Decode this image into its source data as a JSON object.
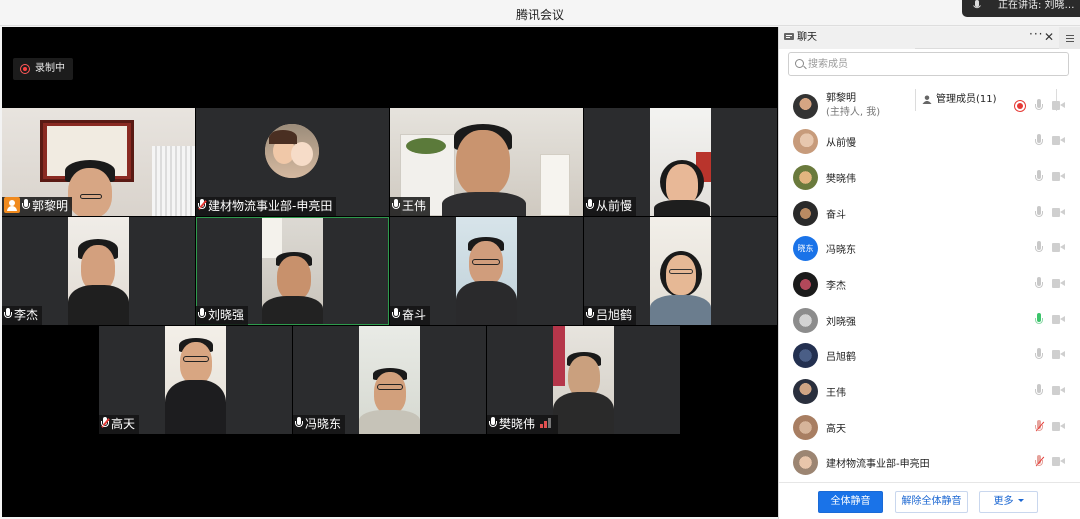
{
  "window": {
    "title": "腾讯会议"
  },
  "speaking_indicator": {
    "text": "正在讲话: 刘晓… "
  },
  "recording": {
    "label": "录制中"
  },
  "video_tiles": [
    {
      "name": "郭黎明",
      "mic": "on",
      "host": true
    },
    {
      "name": "建材物流事业部-申亮田",
      "mic": "muted"
    },
    {
      "name": "王伟",
      "mic": "on"
    },
    {
      "name": "从前慢",
      "mic": "on"
    },
    {
      "name": "李杰",
      "mic": "on"
    },
    {
      "name": "刘晓强",
      "mic": "on",
      "active": true
    },
    {
      "name": "奋斗",
      "mic": "on"
    },
    {
      "name": "吕旭鹤",
      "mic": "on"
    },
    {
      "name": "高天",
      "mic": "muted"
    },
    {
      "name": "冯晓东",
      "mic": "on"
    },
    {
      "name": "樊晓伟",
      "mic": "on",
      "weak_signal": true
    }
  ],
  "panel": {
    "tab_chat": "聊天",
    "tab_members": "管理成员(11)",
    "search_placeholder": "搜索成员",
    "members": [
      {
        "name": "郭黎明",
        "role": "(主持人, 我)",
        "recording": true,
        "mic": "on"
      },
      {
        "name": "从前慢",
        "mic": "on"
      },
      {
        "name": "樊晓伟",
        "mic": "on"
      },
      {
        "name": "奋斗",
        "mic": "on"
      },
      {
        "name": "冯晓东",
        "avatar_text": "晓东",
        "mic": "on"
      },
      {
        "name": "李杰",
        "mic": "on"
      },
      {
        "name": "刘晓强",
        "mic": "speaking"
      },
      {
        "name": "吕旭鹤",
        "mic": "on"
      },
      {
        "name": "王伟",
        "mic": "on"
      },
      {
        "name": "高天",
        "mic": "muted"
      },
      {
        "name": "建材物流事业部-申亮田",
        "mic": "muted"
      }
    ],
    "buttons": {
      "mute_all": "全体静音",
      "unmute_all": "解除全体静音",
      "more": "更多"
    }
  },
  "colors": {
    "accent": "#1a73e8",
    "host_badge": "#f08a1e",
    "active_border": "#2e9a4d",
    "recording": "#e53935"
  }
}
